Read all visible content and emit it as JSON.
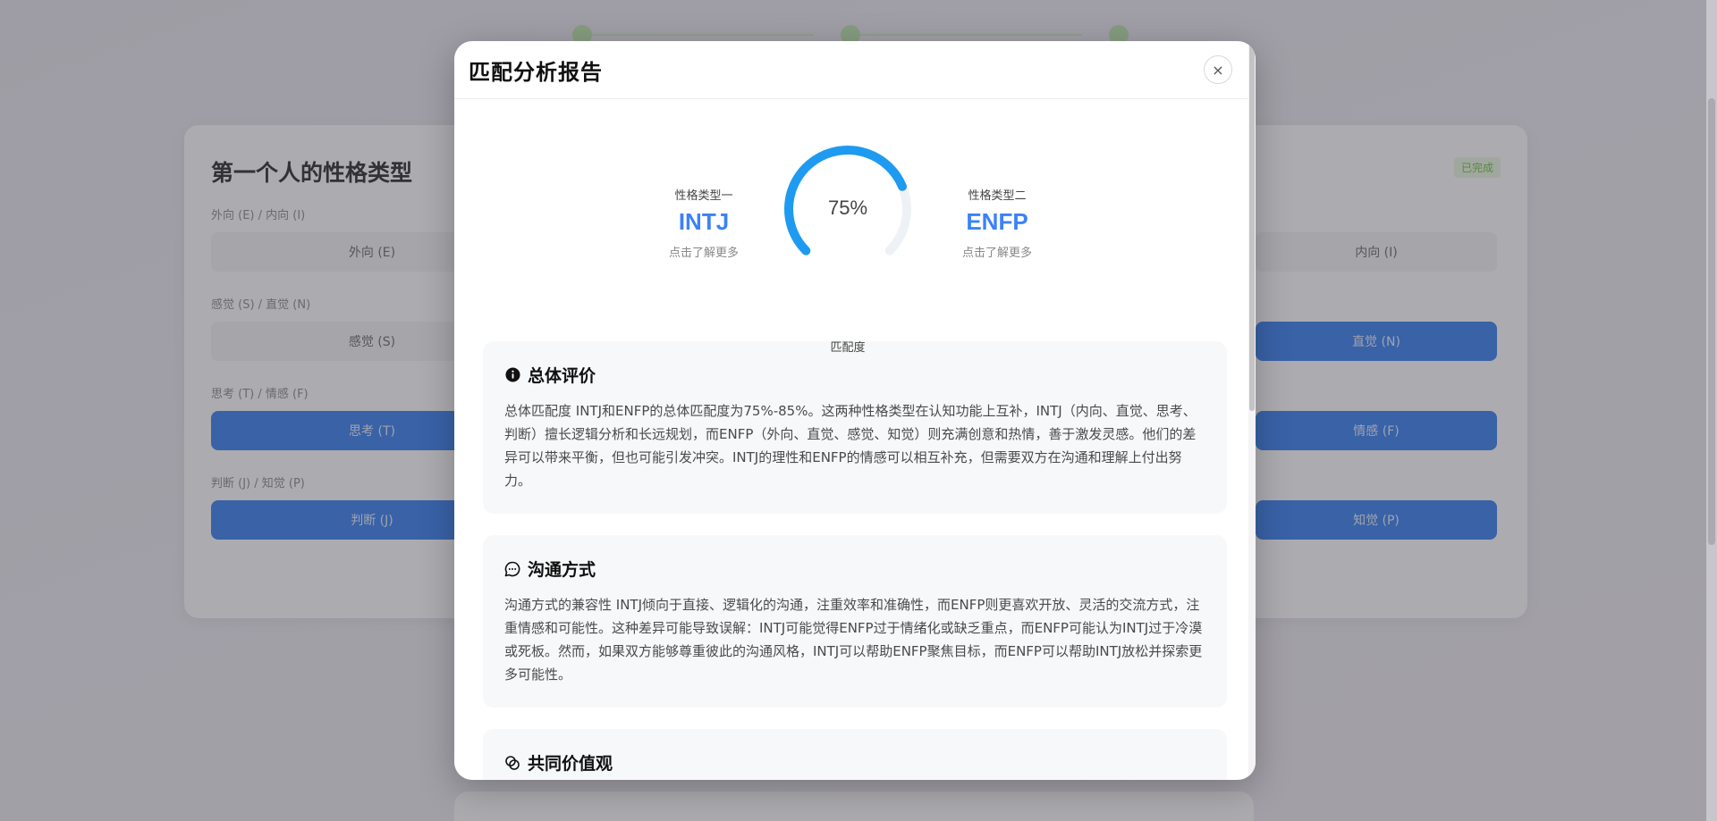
{
  "background": {
    "card_title": "第一个人的性格类型",
    "card_badge": "已完成",
    "questions": [
      {
        "label": "外向 (E) / 内向 (I)",
        "left": "外向 (E)",
        "right": "内向 (I)"
      },
      {
        "label": "感觉 (S) / 直觉 (N)",
        "left": "感觉 (S)",
        "right": "直觉 (N)"
      },
      {
        "label": "思考 (T) / 情感 (F)",
        "left": "思考 (T)",
        "right": "情感 (F)"
      },
      {
        "label": "判断 (J) / 知觉 (P)",
        "left": "判断 (J)",
        "right": "知觉 (P)"
      }
    ]
  },
  "modal": {
    "title": "匹配分析报告",
    "close_icon": "×",
    "type_one": {
      "caption": "性格类型一",
      "code": "INTJ",
      "more": "点击了解更多"
    },
    "type_two": {
      "caption": "性格类型二",
      "code": "ENFP",
      "more": "点击了解更多"
    },
    "score": {
      "value": 75,
      "display": "75%",
      "label": "匹配度"
    },
    "sections": [
      {
        "icon": "info-icon",
        "title": "总体评价",
        "text": "总体匹配度 INTJ和ENFP的总体匹配度为75%-85%。这两种性格类型在认知功能上互补，INTJ（内向、直觉、思考、判断）擅长逻辑分析和长远规划，而ENFP（外向、直觉、感觉、知觉）则充满创意和热情，善于激发灵感。他们的差异可以带来平衡，但也可能引发冲突。INTJ的理性和ENFP的情感可以相互补充，但需要双方在沟通和理解上付出努力。"
      },
      {
        "icon": "chat-icon",
        "title": "沟通方式",
        "text": "沟通方式的兼容性 INTJ倾向于直接、逻辑化的沟通，注重效率和准确性，而ENFP则更喜欢开放、灵活的交流方式，注重情感和可能性。这种差异可能导致误解：INTJ可能觉得ENFP过于情绪化或缺乏重点，而ENFP可能认为INTJ过于冷漠或死板。然而，如果双方能够尊重彼此的沟通风格，INTJ可以帮助ENFP聚焦目标，而ENFP可以帮助INTJ放松并探索更多可能性。"
      },
      {
        "icon": "values-icon",
        "title": "共同价值观",
        "text": ""
      }
    ]
  },
  "colors": {
    "accent": "#3b82f6",
    "gauge_arc": "#1e9bf0",
    "gauge_track": "#eef1f6"
  }
}
